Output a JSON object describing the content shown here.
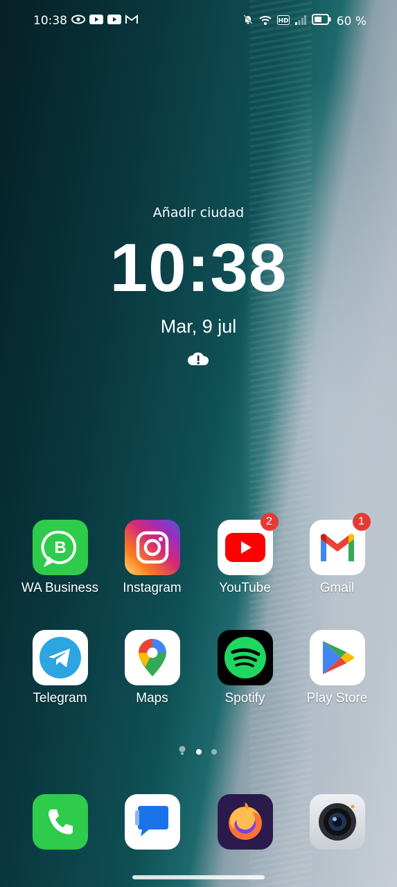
{
  "status_bar": {
    "time": "10:38",
    "battery": "60 %",
    "left_icons": [
      "eye-icon",
      "youtube-icon",
      "youtube-icon",
      "gmail-icon"
    ],
    "right_icons": [
      "bell-off-icon",
      "wifi-icon",
      "hd-icon",
      "signal-icon",
      "battery-icon"
    ]
  },
  "lockwidget": {
    "weather": "Añadir ciudad",
    "time": "10:38",
    "date": "Mar, 9 jul"
  },
  "apps": [
    {
      "label": "WA Business",
      "icon": "whatsapp-business-icon",
      "bg": "#2ecc4a"
    },
    {
      "label": "Instagram",
      "icon": "instagram-icon",
      "bg": "#d62976"
    },
    {
      "label": "YouTube",
      "icon": "youtube-icon",
      "bg": "#ffffff",
      "badge": "2"
    },
    {
      "label": "Gmail",
      "icon": "gmail-icon",
      "bg": "#ffffff",
      "badge": "1"
    },
    {
      "label": "Telegram",
      "icon": "telegram-icon",
      "bg": "#ffffff"
    },
    {
      "label": "Maps",
      "icon": "maps-icon",
      "bg": "#ffffff"
    },
    {
      "label": "Spotify",
      "icon": "spotify-icon",
      "bg": "#000000"
    },
    {
      "label": "Play Store",
      "icon": "play-store-icon",
      "bg": "#ffffff"
    }
  ],
  "dock": [
    {
      "icon": "phone-icon",
      "bg": "#2ecc4a"
    },
    {
      "icon": "messages-icon",
      "bg": "#ffffff"
    },
    {
      "icon": "firefox-icon",
      "bg": "#2a1b4a"
    },
    {
      "icon": "camera-icon",
      "bg": "#d9dde2"
    }
  ],
  "page_indicator": {
    "pages": 2,
    "active": 1
  },
  "colors": {
    "badge": "#e53935",
    "wallpaper_deep": "#0a3840",
    "wallpaper_sand": "#c7ced6"
  }
}
